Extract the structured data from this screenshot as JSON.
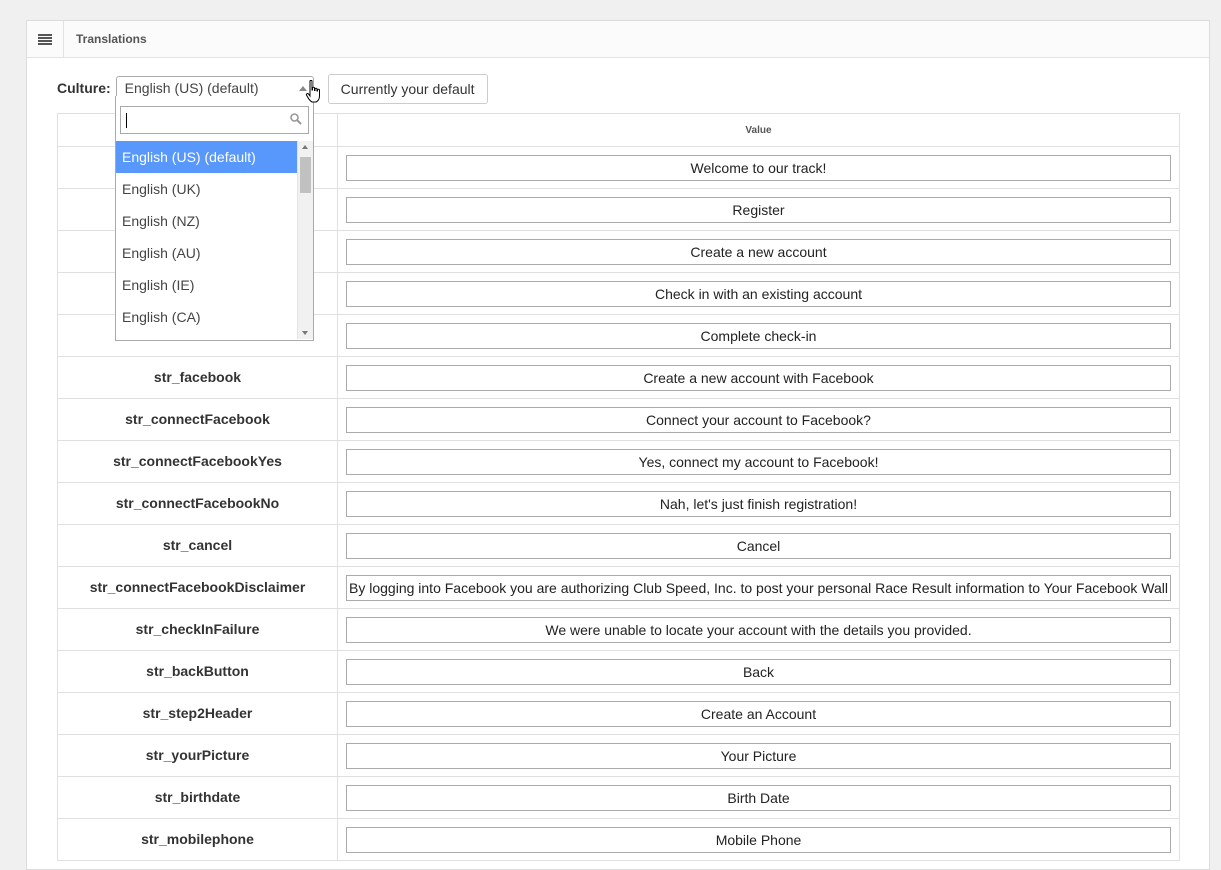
{
  "header": {
    "menu_icon": "hamburger-icon",
    "title": "Translations"
  },
  "culture": {
    "label": "Culture:",
    "selected": "English (US) (default)",
    "default_button": "Currently your default"
  },
  "dropdown": {
    "search_value": "",
    "search_icon": "search-icon",
    "options": [
      "English (US) (default)",
      "English (UK)",
      "English (NZ)",
      "English (AU)",
      "English (IE)",
      "English (CA)"
    ],
    "selected_index": 0,
    "selected_color": "#5897fb"
  },
  "table": {
    "columns": [
      "",
      "Value"
    ],
    "rows": [
      {
        "key": "",
        "value": "Welcome to our track!"
      },
      {
        "key": "",
        "value": "Register"
      },
      {
        "key": "",
        "value": "Create a new account"
      },
      {
        "key": "",
        "value": "Check in with an existing account"
      },
      {
        "key": "",
        "value": "Complete check-in"
      },
      {
        "key": "str_facebook",
        "value": "Create a new account with Facebook"
      },
      {
        "key": "str_connectFacebook",
        "value": "Connect your account to Facebook?"
      },
      {
        "key": "str_connectFacebookYes",
        "value": "Yes, connect my account to Facebook!"
      },
      {
        "key": "str_connectFacebookNo",
        "value": "Nah, let's just finish registration!"
      },
      {
        "key": "str_cancel",
        "value": "Cancel"
      },
      {
        "key": "str_connectFacebookDisclaimer",
        "value": "By logging into Facebook you are authorizing Club Speed, Inc. to post your personal Race Result information to Your Facebook Wall"
      },
      {
        "key": "str_checkInFailure",
        "value": "We were unable to locate your account with the details you provided."
      },
      {
        "key": "str_backButton",
        "value": "Back"
      },
      {
        "key": "str_step2Header",
        "value": "Create an Account"
      },
      {
        "key": "str_yourPicture",
        "value": "Your Picture"
      },
      {
        "key": "str_birthdate",
        "value": "Birth Date"
      },
      {
        "key": "str_mobilephone",
        "value": "Mobile Phone"
      }
    ]
  }
}
